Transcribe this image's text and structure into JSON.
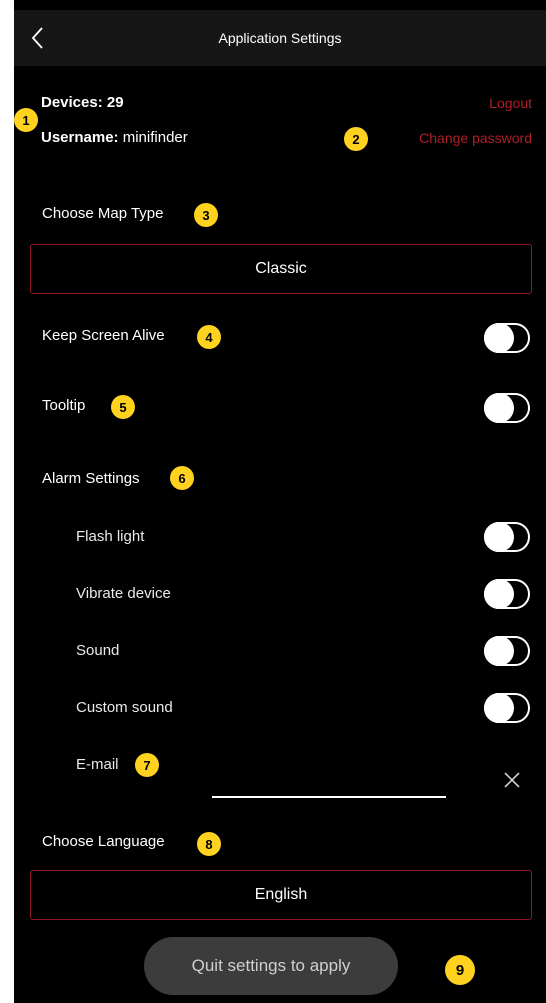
{
  "header": {
    "title": "Application Settings"
  },
  "account": {
    "devices_label": "Devices:",
    "devices_count": "29",
    "username_label": "Username:",
    "username_value": "minifinder",
    "logout_label": "Logout",
    "change_password_label": "Change password"
  },
  "map_type": {
    "label": "Choose Map Type",
    "selected": "Classic"
  },
  "keep_screen_alive": {
    "label": "Keep Screen Alive",
    "enabled": false
  },
  "tooltip": {
    "label": "Tooltip",
    "enabled": false
  },
  "alarm_settings": {
    "label": "Alarm Settings",
    "items": [
      {
        "label": "Flash light",
        "enabled": false
      },
      {
        "label": "Vibrate device",
        "enabled": false
      },
      {
        "label": "Sound",
        "enabled": false
      },
      {
        "label": "Custom sound",
        "enabled": false
      }
    ],
    "email_label": "E-mail",
    "email_value": ""
  },
  "language": {
    "label": "Choose Language",
    "selected": "English"
  },
  "apply_button": {
    "label": "Quit settings to apply"
  },
  "badges": [
    "1",
    "2",
    "3",
    "4",
    "5",
    "6",
    "7",
    "8",
    "9"
  ],
  "icons": {
    "back": "chevron-left-icon",
    "clear": "close-icon"
  },
  "colors": {
    "accent_red": "#b11e27",
    "badge_yellow": "#ffd21f",
    "background": "#000000"
  }
}
